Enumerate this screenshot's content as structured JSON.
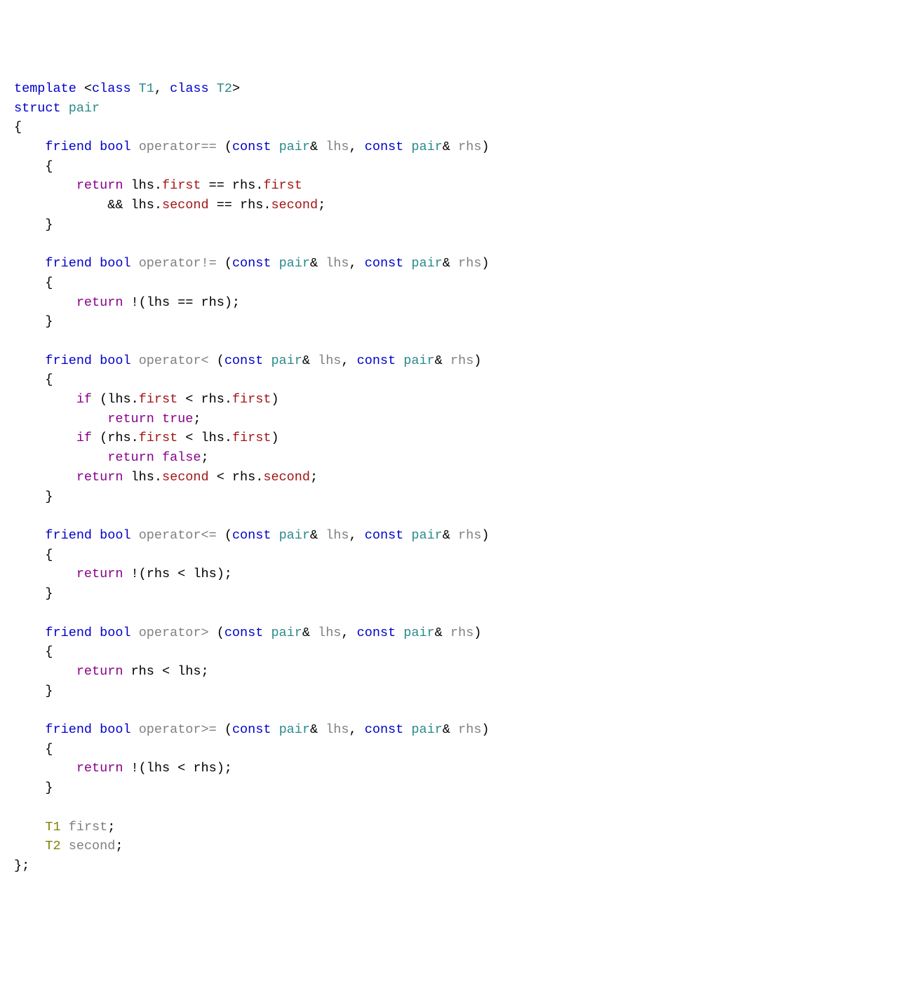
{
  "c": {
    "kw": {
      "template": "template",
      "class": "class",
      "struct": "struct",
      "friend": "friend",
      "bool": "bool",
      "const": "const"
    },
    "type": {
      "T1": "T1",
      "T2": "T2",
      "pair": "pair"
    },
    "op": {
      "eq": "operator==",
      "ne": "operator!=",
      "lt": "operator<",
      "le": "operator<=",
      "gt": "operator>",
      "ge": "operator>="
    },
    "ctrl": {
      "return": "return",
      "if": "if",
      "true": "true",
      "false": "false"
    },
    "mem": {
      "first": "first",
      "second": "second"
    },
    "id": {
      "lhs": "lhs",
      "rhs": "rhs"
    },
    "p": {
      "tmpl_open": " <",
      "tmpl_mid": ", ",
      "tmpl_close": ">",
      "sp": " ",
      "ob": "{",
      "cb": "}",
      "cbs": "};",
      "lp": " (",
      "amp_sp": "& ",
      "comma": ", ",
      "rp": ")",
      "dot": ".",
      "eqeq": " == ",
      "andand": "&& ",
      "semi": ";",
      "bang_lp": " !(",
      "lt": " < ",
      "rps": ");"
    }
  }
}
